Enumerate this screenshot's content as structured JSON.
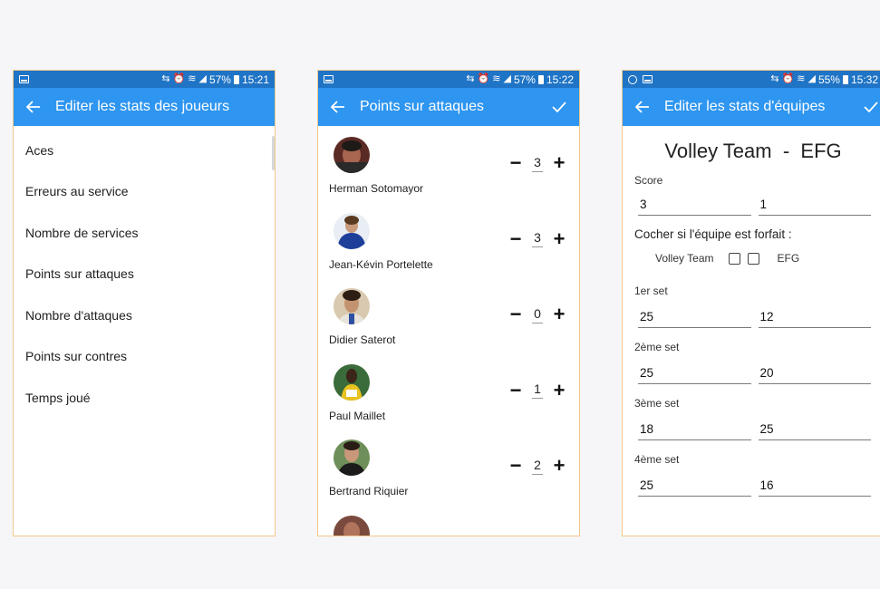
{
  "colors": {
    "statusbar": "#1f74c6",
    "appbar": "#2e95f0",
    "frame_border": "#f0c88c",
    "background": "#f6f6f8"
  },
  "screens": [
    {
      "status": {
        "battery": "57%",
        "time": "15:21",
        "left_icons": [
          "image-icon"
        ]
      },
      "title": "Editer les stats des joueurs",
      "menu": [
        "Aces",
        "Erreurs au service",
        "Nombre de services",
        "Points sur attaques",
        "Nombre d'attaques",
        "Points sur contres",
        "Temps joué"
      ]
    },
    {
      "status": {
        "battery": "57%",
        "time": "15:22",
        "left_icons": [
          "image-icon"
        ]
      },
      "title": "Points sur attaques",
      "players": [
        {
          "name": "Herman Sotomayor",
          "value": "3"
        },
        {
          "name": "Jean-Kévin Portelette",
          "value": "3"
        },
        {
          "name": "Didier Saterot",
          "value": "0"
        },
        {
          "name": "Paul Maillet",
          "value": "1"
        },
        {
          "name": "Bertrand Riquier",
          "value": "2"
        }
      ],
      "minus_label": "−",
      "plus_label": "+"
    },
    {
      "status": {
        "battery": "55%",
        "time": "15:32",
        "left_icons": [
          "settings-icon",
          "image-icon"
        ]
      },
      "title": "Editer les stats d'équipes",
      "team_a": "Volley Team",
      "separator": "-",
      "team_b": "EFG",
      "score_label": "Score",
      "score": [
        "3",
        "1"
      ],
      "forfeit_label": "Cocher si l'équipe est forfait :",
      "forfeit_team_a": "Volley Team",
      "forfeit_team_b": "EFG",
      "sets": [
        {
          "label": "1er set",
          "a": "25",
          "b": "12"
        },
        {
          "label": "2ème set",
          "a": "25",
          "b": "20"
        },
        {
          "label": "3ème set",
          "a": "18",
          "b": "25"
        },
        {
          "label": "4ème set",
          "a": "25",
          "b": "16"
        }
      ]
    }
  ]
}
